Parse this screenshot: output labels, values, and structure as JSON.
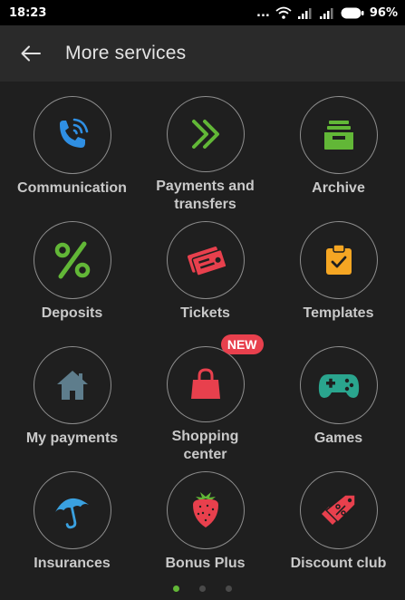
{
  "status_bar": {
    "time": "18:23",
    "dots": "...",
    "battery_percent": "96%"
  },
  "header": {
    "title": "More services",
    "back_icon": "arrow-left-icon"
  },
  "services": [
    {
      "label": "Communication",
      "icon": "phone-signal-icon",
      "color": "#2f8fe3"
    },
    {
      "label": "Payments and\ntransfers",
      "icon": "double-chevron-icon",
      "color": "#62b737"
    },
    {
      "label": "Archive",
      "icon": "archive-tray-icon",
      "color": "#62b737"
    },
    {
      "label": "Deposits",
      "icon": "percent-icon",
      "color": "#62b737"
    },
    {
      "label": "Tickets",
      "icon": "tickets-icon",
      "color": "#e8404d"
    },
    {
      "label": "Templates",
      "icon": "clipboard-check-icon",
      "color": "#f5a623"
    },
    {
      "label": "My payments",
      "icon": "house-icon",
      "color": "#5e7d8c"
    },
    {
      "label": "Shopping\ncenter",
      "icon": "shopping-bag-icon",
      "color": "#e8404d",
      "badge": "NEW"
    },
    {
      "label": "Games",
      "icon": "gamepad-icon",
      "color": "#2aa58e"
    },
    {
      "label": "Insurances",
      "icon": "umbrella-icon",
      "color": "#3aa1e0"
    },
    {
      "label": "Bonus Plus",
      "icon": "strawberry-icon",
      "color": "#e8404d"
    },
    {
      "label": "Discount club",
      "icon": "discount-tag-icon",
      "color": "#e8404d"
    }
  ],
  "pager": {
    "pages": 3,
    "current": 1,
    "active_color": "#62b737"
  }
}
